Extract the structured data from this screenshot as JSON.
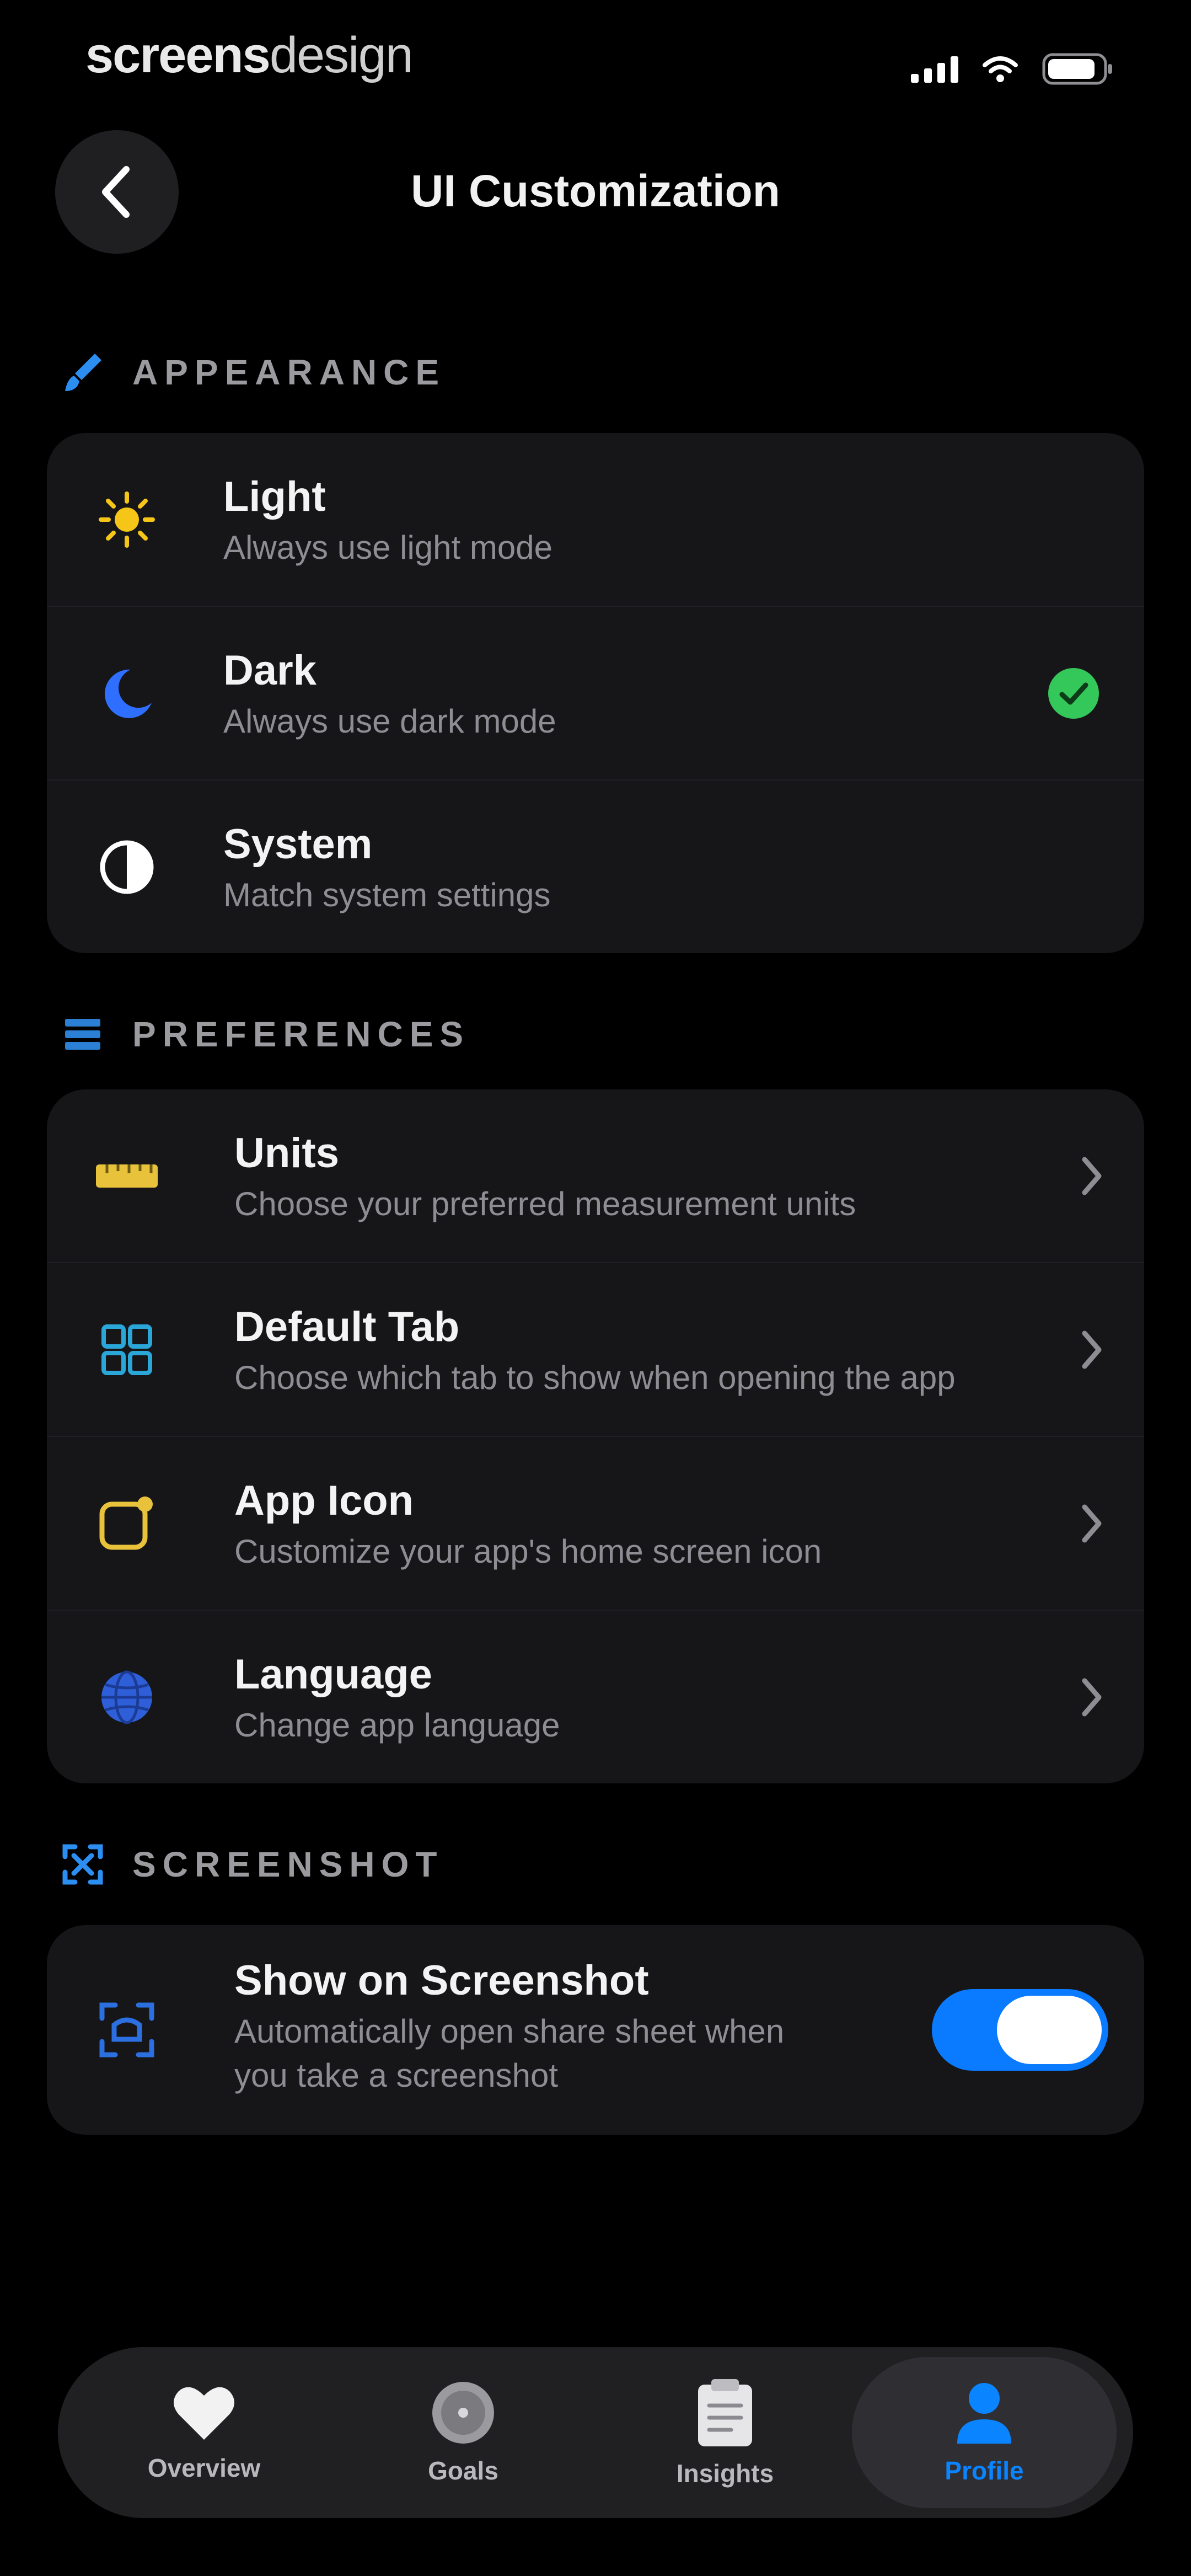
{
  "status_bar": {
    "brand_bold": "screens",
    "brand_light": "design",
    "icons": [
      "signal-icon",
      "wifi-icon",
      "battery-icon"
    ]
  },
  "header": {
    "title": "UI Customization",
    "back_icon": "chevron-left-icon"
  },
  "appearance": {
    "section_label": "APPEARANCE",
    "section_icon": "paintbrush-icon",
    "selected": "Dark",
    "options": [
      {
        "label": "Light",
        "description": "Always use light mode",
        "icon": "sun-icon",
        "icon_color": "#f5c518"
      },
      {
        "label": "Dark",
        "description": "Always use dark mode",
        "icon": "moon-icon",
        "icon_color": "#2f6fff"
      },
      {
        "label": "System",
        "description": "Match system settings",
        "icon": "contrast-icon",
        "icon_color": "#ffffff"
      }
    ]
  },
  "preferences": {
    "section_label": "PREFERENCES",
    "section_icon": "list-icon",
    "items": [
      {
        "label": "Units",
        "description": "Choose your preferred measurement units",
        "icon": "ruler-icon",
        "icon_color": "#e8c23a"
      },
      {
        "label": "Default Tab",
        "description": "Choose which tab to show when opening the app",
        "icon": "grid-icon",
        "icon_color": "#2aa7d8"
      },
      {
        "label": "App Icon",
        "description": "Customize your app's home screen icon",
        "icon": "app-icon-icon",
        "icon_color": "#e8c23a"
      },
      {
        "label": "Language",
        "description": "Change app language",
        "icon": "globe-icon",
        "icon_color": "#2f6fff"
      }
    ]
  },
  "screenshot": {
    "section_label": "SCREENSHOT",
    "section_icon": "screenshot-icon",
    "title": "Show on Screenshot",
    "description_line1": "Automatically open share sheet when",
    "description_line2": "you take a screenshot",
    "enabled": true
  },
  "tab_bar": {
    "active": "Profile",
    "tabs": [
      {
        "label": "Overview",
        "icon": "heart-icon"
      },
      {
        "label": "Goals",
        "icon": "target-icon"
      },
      {
        "label": "Insights",
        "icon": "clipboard-icon"
      },
      {
        "label": "Profile",
        "icon": "person-icon"
      }
    ]
  },
  "colors": {
    "background": "#000000",
    "card": "#161619",
    "accent_blue": "#0a84ff",
    "check_green": "#34c759",
    "section_label": "#9a9a9f"
  }
}
